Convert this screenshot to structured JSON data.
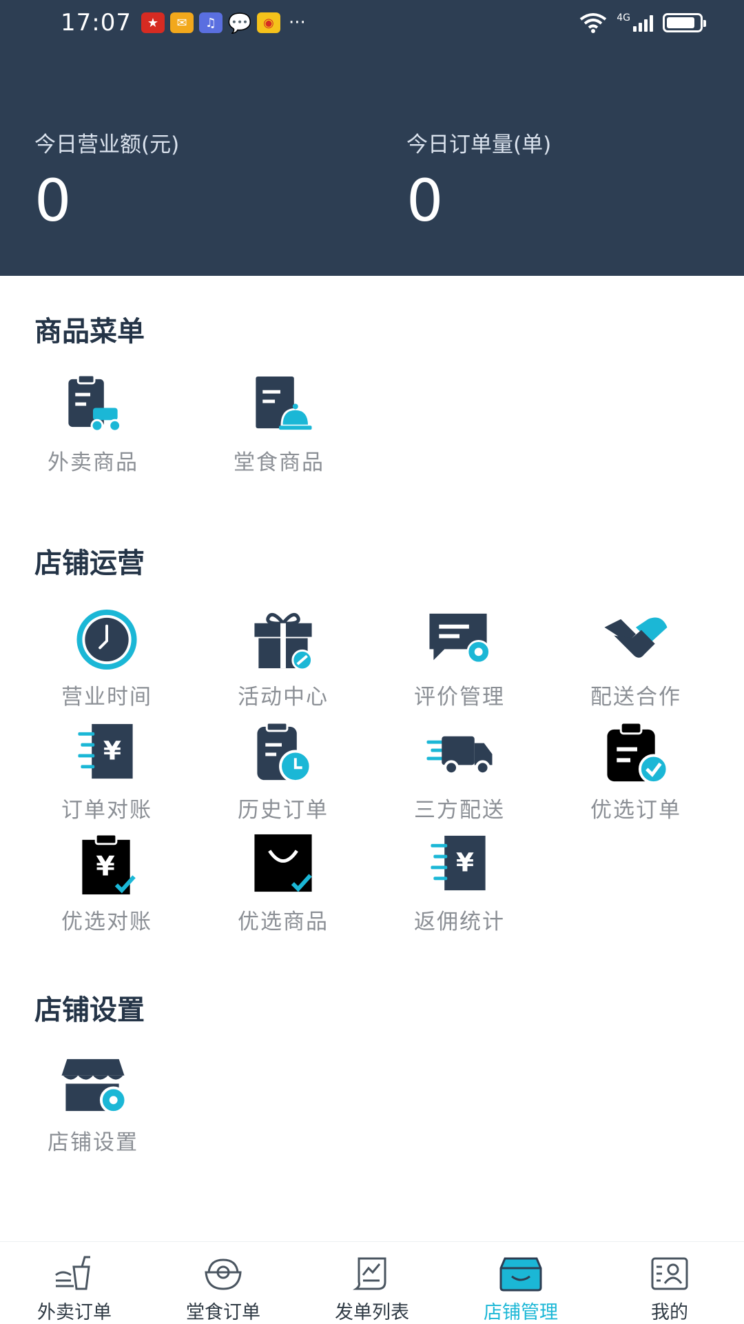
{
  "status_bar": {
    "time": "17:07",
    "network": "4G",
    "more": "···"
  },
  "stats": [
    {
      "label": "今日营业额(元)",
      "value": "0"
    },
    {
      "label": "今日订单量(单)",
      "value": "0"
    }
  ],
  "sections": {
    "goods": {
      "title": "商品菜单",
      "items": [
        "外卖商品",
        "堂食商品"
      ]
    },
    "operations": {
      "title": "店铺运营",
      "items": [
        "营业时间",
        "活动中心",
        "评价管理",
        "配送合作",
        "订单对账",
        "历史订单",
        "三方配送",
        "优选订单",
        "优选对账",
        "优选商品",
        "返佣统计"
      ]
    },
    "settings": {
      "title": "店铺设置",
      "items": [
        "店铺设置"
      ]
    }
  },
  "nav": {
    "items": [
      "外卖订单",
      "堂食订单",
      "发单列表",
      "店铺管理",
      "我的"
    ],
    "active_index": 3
  },
  "colors": {
    "header": "#2d3e53",
    "accent": "#1bb7d6",
    "icon_dark": "#2d3e53"
  }
}
